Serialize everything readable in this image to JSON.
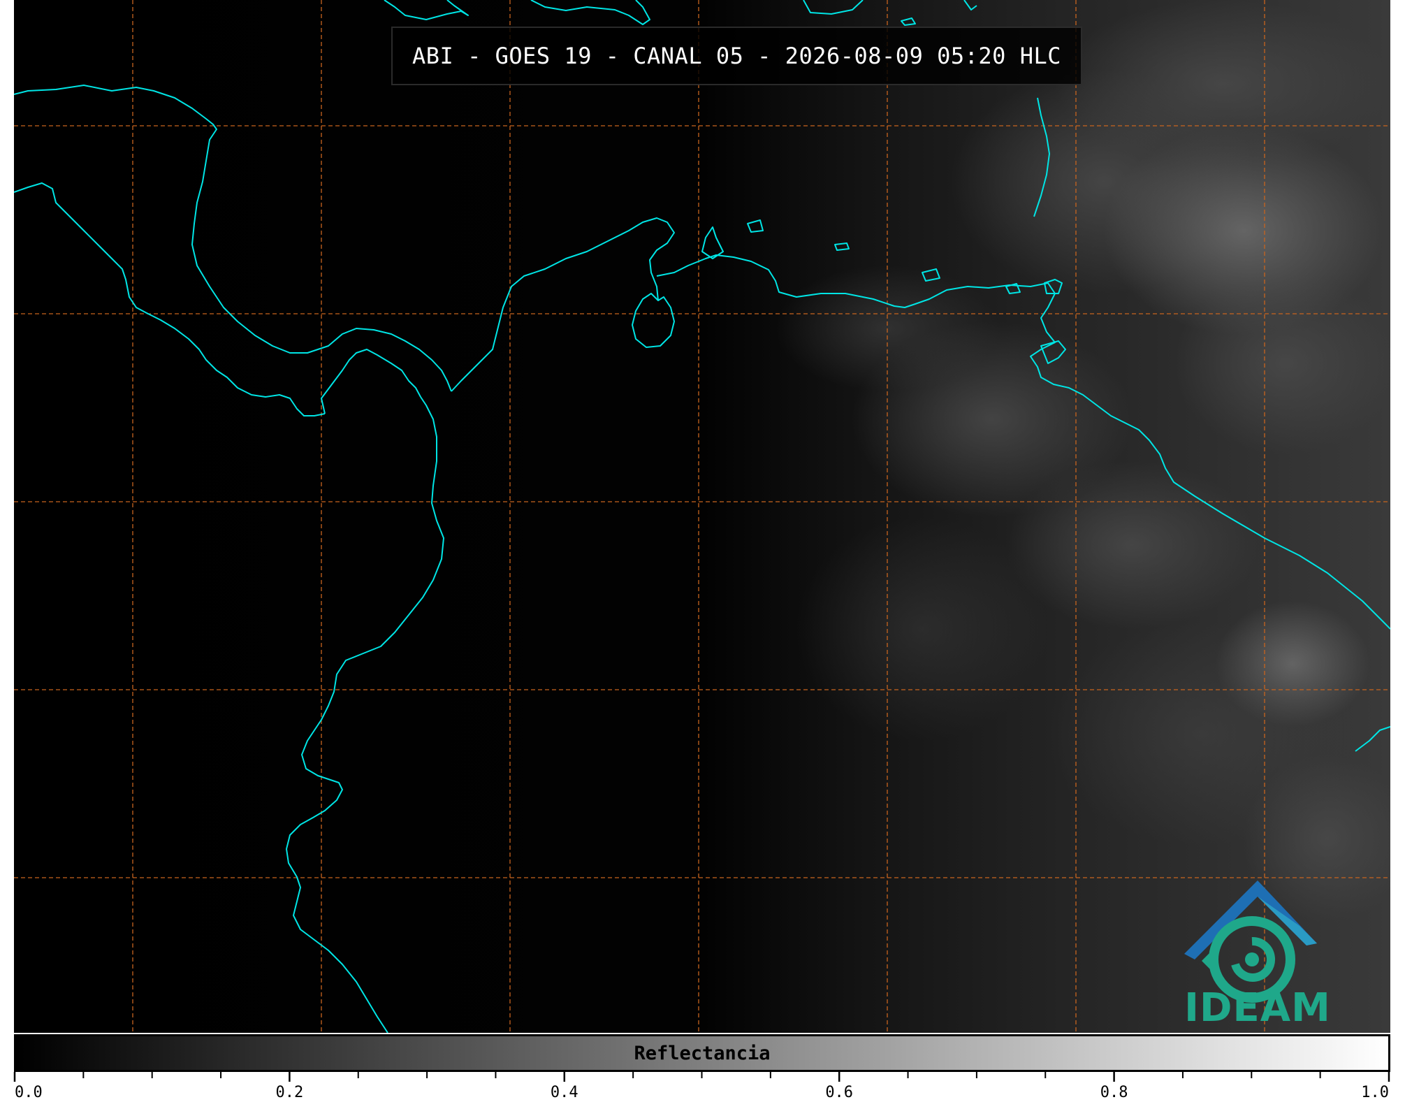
{
  "title": "ABI - GOES 19 - CANAL 05 - 2026-08-09 05:20 HLC",
  "logo_text": "IDEAM",
  "colorbar": {
    "label": "Reflectancia",
    "min": 0.0,
    "max": 1.0,
    "major_ticks": [
      0.0,
      0.2,
      0.4,
      0.6,
      0.8,
      1.0
    ],
    "major_tick_labels": [
      "0.0",
      "0.2",
      "0.4",
      "0.6",
      "0.8",
      "1.0"
    ],
    "minor_step": 0.05,
    "colormap_start": "#000000",
    "colormap_end": "#ffffff"
  },
  "colors": {
    "coastline": "#00e5e5",
    "gridline": "#c8641e",
    "logo_blue": "#1e6fb4",
    "logo_green": "#1fa88a"
  },
  "grid": {
    "style": "dashed",
    "visible": true
  }
}
